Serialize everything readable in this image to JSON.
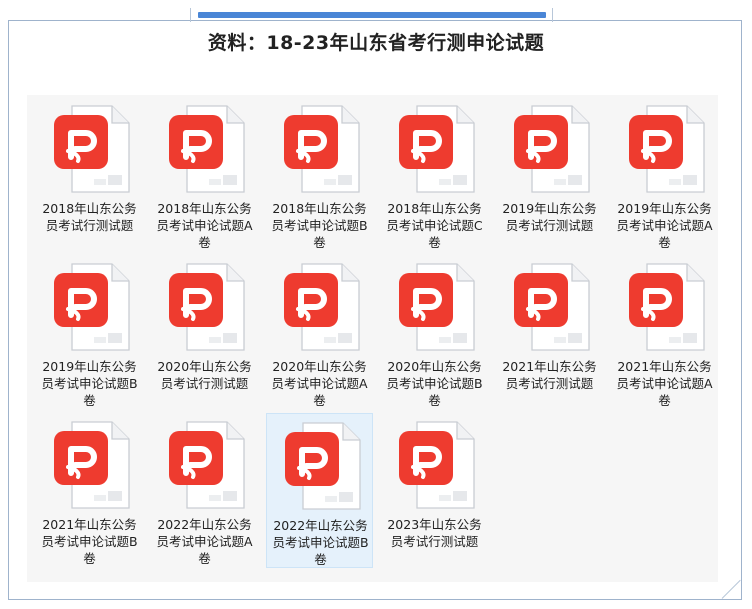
{
  "title": "资料：18-23年山东省考行测申论试题",
  "files": [
    {
      "name": "2018年山东公务员考试行测试题",
      "icon": "pdf-file-icon"
    },
    {
      "name": "2018年山东公务员考试申论试题A卷",
      "icon": "pdf-file-icon"
    },
    {
      "name": "2018年山东公务员考试申论试题B卷",
      "icon": "pdf-file-icon"
    },
    {
      "name": "2018年山东公务员考试申论试题C卷",
      "icon": "pdf-file-icon"
    },
    {
      "name": "2019年山东公务员考试行测试题",
      "icon": "pdf-file-icon"
    },
    {
      "name": "2019年山东公务员考试申论试题A卷",
      "icon": "pdf-file-icon"
    },
    {
      "name": "2019年山东公务员考试申论试题B卷",
      "icon": "pdf-file-icon"
    },
    {
      "name": "2020年山东公务员考试行测试题",
      "icon": "pdf-file-icon"
    },
    {
      "name": "2020年山东公务员考试申论试题A卷",
      "icon": "pdf-file-icon"
    },
    {
      "name": "2020年山东公务员考试申论试题B卷",
      "icon": "pdf-file-icon"
    },
    {
      "name": "2021年山东公务员考试行测试题",
      "icon": "pdf-file-icon"
    },
    {
      "name": "2021年山东公务员考试申论试题A卷",
      "icon": "pdf-file-icon"
    },
    {
      "name": "2021年山东公务员考试申论试题B卷",
      "icon": "pdf-file-icon"
    },
    {
      "name": "2022年山东公务员考试申论试题A卷",
      "icon": "pdf-file-icon"
    },
    {
      "name": "2022年山东公务员考试申论试题B卷",
      "icon": "pdf-file-icon",
      "selected": true
    },
    {
      "name": "2023年山东公务员考试行测试题",
      "icon": "pdf-file-icon"
    }
  ],
  "colors": {
    "accent": "#4a86d6",
    "pdf_red": "#ee3b2f",
    "selection": "#e5f1fb"
  }
}
